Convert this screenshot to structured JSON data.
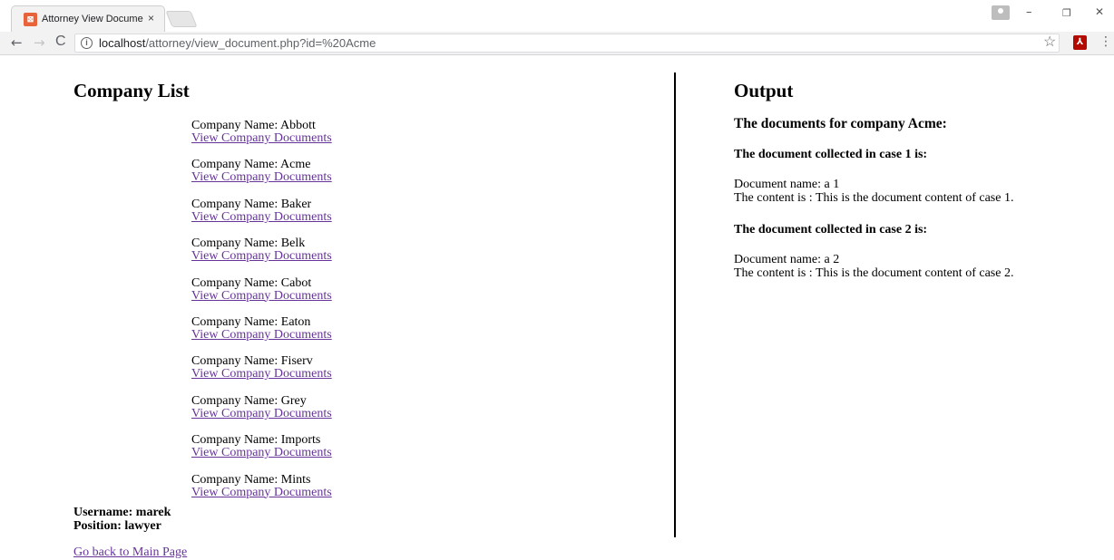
{
  "browser": {
    "tab_title": "Attorney View Documen",
    "tab_close": "×",
    "url_host": "localhost",
    "url_path": "/attorney/view_document.php?id=%20Acme",
    "back": "←",
    "forward": "→",
    "reload": "C",
    "star": "☆",
    "menu": "⋮",
    "minimize": "–",
    "restore": "❐",
    "close": "✕"
  },
  "left": {
    "title": "Company List",
    "name_prefix": "Company Name: ",
    "companies": [
      {
        "name": "Abbott",
        "link": "View Company Documents"
      },
      {
        "name": "Acme",
        "link": "View Company Documents"
      },
      {
        "name": "Baker",
        "link": "View Company Documents"
      },
      {
        "name": "Belk",
        "link": "View Company Documents"
      },
      {
        "name": "Cabot",
        "link": "View Company Documents"
      },
      {
        "name": "Eaton",
        "link": "View Company Documents"
      },
      {
        "name": "Fiserv",
        "link": "View Company Documents"
      },
      {
        "name": "Grey",
        "link": "View Company Documents"
      },
      {
        "name": "Imports",
        "link": "View Company Documents"
      },
      {
        "name": "Mints",
        "link": "View Company Documents"
      }
    ],
    "username": "Username: marek",
    "position": "Position: lawyer",
    "back_link": "Go back to Main Page"
  },
  "right": {
    "title": "Output",
    "heading": "The documents for company Acme:",
    "cases": [
      {
        "heading": "The document collected in case 1 is:",
        "doc_name": "Document name: a 1",
        "content": "The content is : This is the document content of case 1."
      },
      {
        "heading": "The document collected in case 2 is:",
        "doc_name": "Document name: a 2",
        "content": "The content is : This is the document content of case 2."
      }
    ]
  }
}
